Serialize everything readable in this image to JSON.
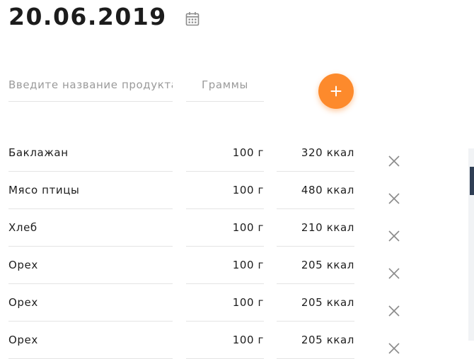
{
  "header": {
    "date": "20.06.2019",
    "calendar_icon": "calendar-icon"
  },
  "form": {
    "product_placeholder": "Введите название продукта",
    "grams_placeholder": "Граммы",
    "add_icon": "plus-icon",
    "add_button_color": "#fd8a2c"
  },
  "entries": [
    {
      "name": "Баклажан",
      "grams": "100 г",
      "kcal": "320 ккал"
    },
    {
      "name": "Мясо птицы",
      "grams": "100 г",
      "kcal": "480 ккал"
    },
    {
      "name": "Хлеб",
      "grams": "100 г",
      "kcal": "210 ккал"
    },
    {
      "name": "Орех",
      "grams": "100 г",
      "kcal": "205 ккал"
    },
    {
      "name": "Орех",
      "grams": "100 г",
      "kcal": "205 ккал"
    },
    {
      "name": "Орех",
      "grams": "100 г",
      "kcal": "205 ккал"
    }
  ],
  "delete_icon": "close-icon",
  "colors": {
    "accent": "#fd8a2c",
    "text": "#1d1d1d",
    "placeholder": "#9a9a9a",
    "divider": "#e4e4e4",
    "icon": "#8a8a8a",
    "scroll_thumb": "#2f3e54"
  }
}
